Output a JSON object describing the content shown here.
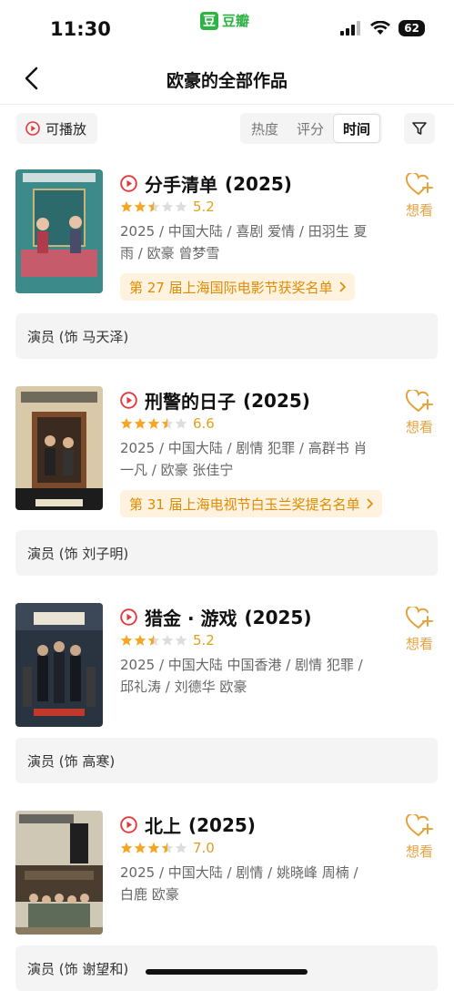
{
  "status_bar": {
    "time": "11:30",
    "battery": "62"
  },
  "brand": {
    "logo": "豆",
    "name": "豆瓣"
  },
  "header": {
    "title": "欧豪的全部作品"
  },
  "filters": {
    "playable": "可播放",
    "sort": [
      "热度",
      "评分",
      "时间"
    ],
    "active_sort": "时间"
  },
  "colors": {
    "accent": "#e6a23c",
    "play_red": "#e4393c",
    "brand_green": "#2fb344",
    "star": "#f5a623"
  },
  "works": [
    {
      "title": "分手清单",
      "year": "(2025)",
      "rating": "5.2",
      "stars": 2.5,
      "meta": "2025 / 中国大陆 / 喜剧 爱情 / 田羽生 夏雨 / 欧豪 曾梦雪",
      "award": "第 27 届上海国际电影节获奖名单",
      "wish": "想看",
      "role": "演员 (饰 马天泽)"
    },
    {
      "title": "刑警的日子",
      "year": "(2025)",
      "rating": "6.6",
      "stars": 3.5,
      "meta": "2025 / 中国大陆 / 剧情 犯罪 / 高群书 肖一凡 / 欧豪 张佳宁",
      "award": "第 31 届上海电视节白玉兰奖提名名单",
      "wish": "想看",
      "role": "演员 (饰 刘子明)"
    },
    {
      "title": "猎金 · 游戏",
      "year": "(2025)",
      "rating": "5.2",
      "stars": 2.5,
      "meta": "2025 / 中国大陆 中国香港 / 剧情 犯罪 / 邱礼涛 / 刘德华 欧豪",
      "award": "",
      "wish": "想看",
      "role": "演员 (饰 高寒)"
    },
    {
      "title": "北上",
      "year": "(2025)",
      "rating": "7.0",
      "stars": 3.5,
      "meta": "2025 / 中国大陆 / 剧情 / 姚晓峰 周楠 / 白鹿 欧豪",
      "award": "",
      "wish": "想看",
      "role": "演员 (饰 谢望和)"
    }
  ]
}
